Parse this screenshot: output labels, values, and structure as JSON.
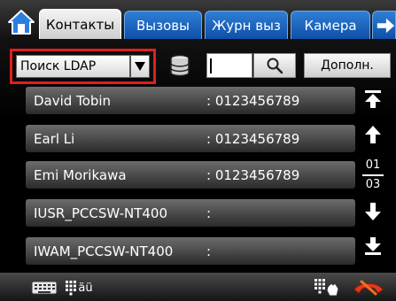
{
  "tabs": [
    {
      "label": "Контакты",
      "active": true
    },
    {
      "label": "Вызовы",
      "active": false
    },
    {
      "label": "Журн выз",
      "active": false
    },
    {
      "label": "Камера",
      "active": false
    }
  ],
  "toolbar": {
    "ldap_select_value": "Поиск LDAP",
    "search_value": "",
    "more_label": "Дополн."
  },
  "contacts": [
    {
      "name": "David Tobin",
      "number": ": 0123456789"
    },
    {
      "name": "Earl Li",
      "number": ": 0123456789"
    },
    {
      "name": "Emi Morikawa",
      "number": ": 0123456789"
    },
    {
      "name": "IUSR_PCCSW-NT400",
      "number": ":"
    },
    {
      "name": "IWAM_PCCSW-NT400",
      "number": ":"
    }
  ],
  "pager": {
    "current": "01",
    "total": "03"
  },
  "bottombar": {
    "abc_label": "äü"
  },
  "colors": {
    "tab_blue": "#1a63bf",
    "highlight_red": "#e0201e",
    "row_gray": "#4a4a4a",
    "hangup_red": "#e23a1a"
  },
  "icons": [
    "home-icon",
    "right-arrow-icon",
    "dropdown-arrow-icon",
    "database-icon",
    "search-icon",
    "first-page-icon",
    "page-up-icon",
    "page-down-icon",
    "last-page-icon",
    "keyboard-icon",
    "abc-keypad-icon",
    "dialpad-icon",
    "hangup-icon"
  ]
}
